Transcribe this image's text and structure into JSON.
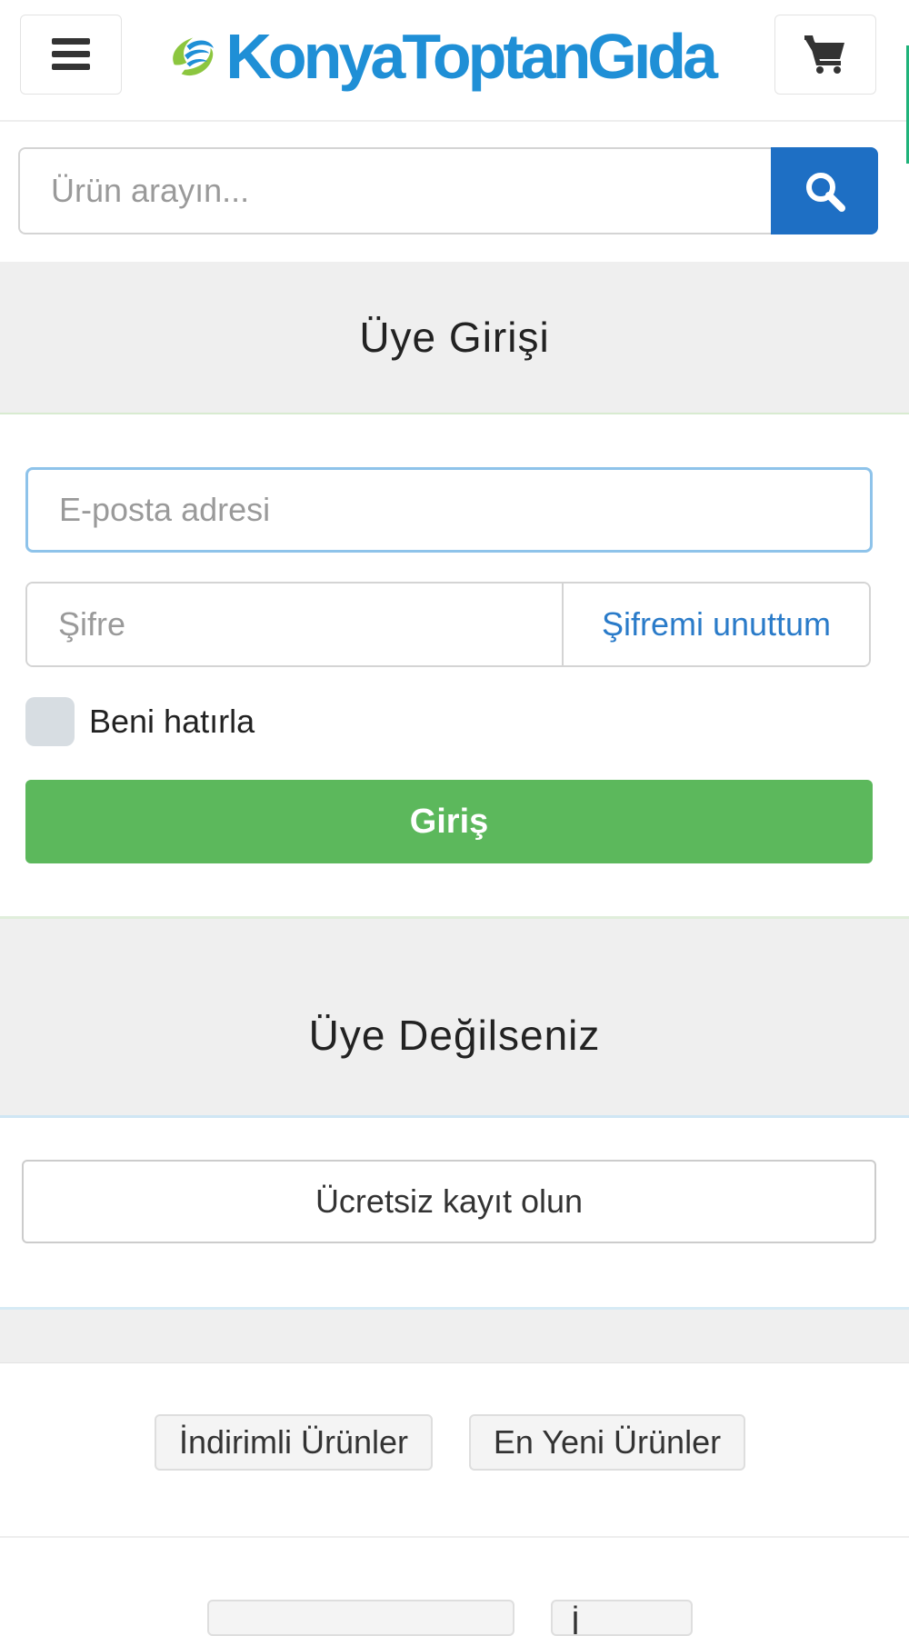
{
  "header": {
    "menu_icon": "hamburger-menu-icon",
    "cart_icon": "shopping-cart-icon",
    "logo": {
      "part1": "Konya",
      "part2": "Toptan",
      "part3": "Gıda",
      "brand_color": "#1f8fd6",
      "accent_color": "#8cc63f"
    }
  },
  "search": {
    "placeholder": "Ürün arayın...",
    "button_icon": "search-icon",
    "button_color": "#1e6fc4"
  },
  "login": {
    "title": "Üye Girişi",
    "email_placeholder": "E-posta adresi",
    "password_placeholder": "Şifre",
    "forgot_label": "Şifremi unuttum",
    "remember_label": "Beni hatırla",
    "remember_checked": false,
    "submit_label": "Giriş",
    "submit_color": "#5cb85c"
  },
  "signup": {
    "title": "Üye Değilseniz",
    "button_label": "Ücretsiz kayıt olun"
  },
  "footer_links": [
    {
      "label": "İndirimli Ürünler"
    },
    {
      "label": "En Yeni Ürünler"
    }
  ],
  "cut_off_links": [
    {
      "label": "İ"
    }
  ]
}
